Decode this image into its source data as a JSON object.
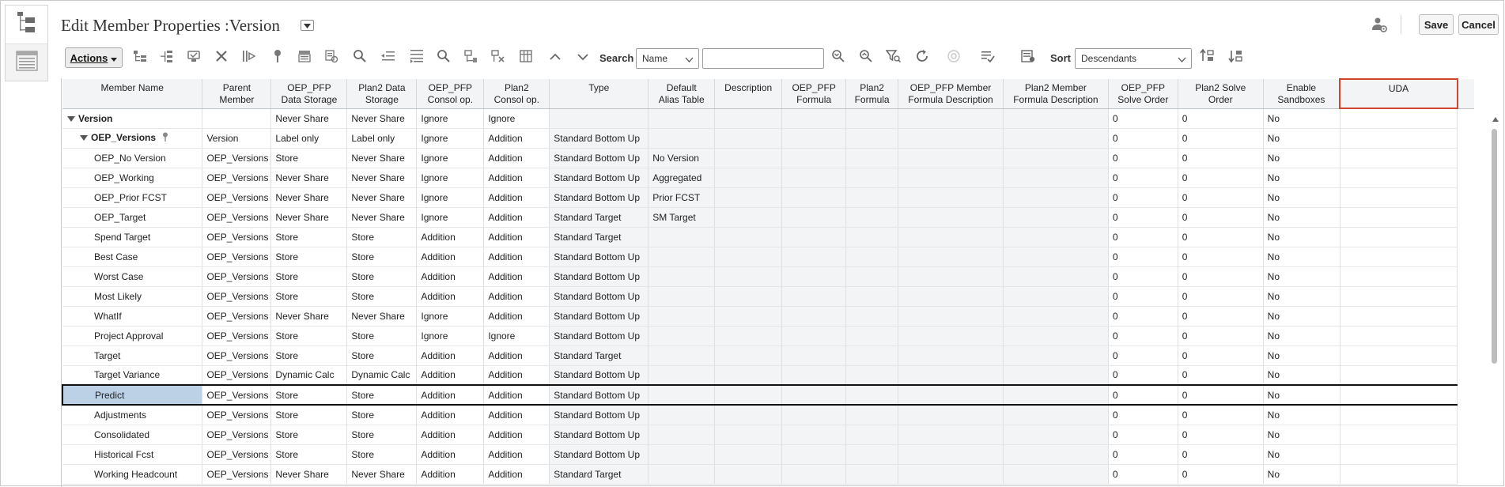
{
  "page": {
    "title": "Edit Member Properties :Version",
    "save_label": "Save",
    "cancel_label": "Cancel"
  },
  "toolbar": {
    "actions_label": "Actions",
    "search_label": "Search",
    "search_field_value": "Name",
    "search_input_value": "",
    "sort_label": "Sort",
    "sort_value": "Descendants"
  },
  "grid": {
    "columns": [
      "Member Name",
      "Parent Member",
      "OEP_PFP Data Storage",
      "Plan2 Data Storage",
      "OEP_PFP Consol op.",
      "Plan2 Consol op.",
      "Type",
      "Default Alias Table",
      "Description",
      "OEP_PFP Formula",
      "Plan2 Formula",
      "OEP_PFP Member Formula Description",
      "Plan2 Member Formula Description",
      "OEP_PFP Solve Order",
      "Plan2 Solve Order",
      "Enable Sandboxes",
      "UDA"
    ],
    "rows": [
      [
        "Version",
        "",
        "Never Share",
        "Never Share",
        "Ignore",
        "Ignore",
        "",
        "",
        "",
        "",
        "",
        "",
        "",
        "0",
        "0",
        "No",
        ""
      ],
      [
        "OEP_Versions",
        "Version",
        "Label only",
        "Label only",
        "Ignore",
        "Addition",
        "Standard Bottom Up",
        "",
        "",
        "",
        "",
        "",
        "",
        "0",
        "0",
        "No",
        ""
      ],
      [
        "OEP_No Version",
        "OEP_Versions",
        "Store",
        "Never Share",
        "Ignore",
        "Addition",
        "Standard Bottom Up",
        "No Version",
        "",
        "",
        "",
        "",
        "",
        "0",
        "0",
        "No",
        ""
      ],
      [
        "OEP_Working",
        "OEP_Versions",
        "Never Share",
        "Never Share",
        "Ignore",
        "Addition",
        "Standard Bottom Up",
        "Aggregated",
        "",
        "",
        "",
        "",
        "",
        "0",
        "0",
        "No",
        ""
      ],
      [
        "OEP_Prior FCST",
        "OEP_Versions",
        "Never Share",
        "Never Share",
        "Ignore",
        "Addition",
        "Standard Bottom Up",
        "Prior FCST",
        "",
        "",
        "",
        "",
        "",
        "0",
        "0",
        "No",
        ""
      ],
      [
        "OEP_Target",
        "OEP_Versions",
        "Never Share",
        "Never Share",
        "Ignore",
        "Addition",
        "Standard Target",
        "SM Target",
        "",
        "",
        "",
        "",
        "",
        "0",
        "0",
        "No",
        ""
      ],
      [
        "Spend Target",
        "OEP_Versions",
        "Store",
        "Store",
        "Addition",
        "Addition",
        "Standard Target",
        "",
        "",
        "",
        "",
        "",
        "",
        "0",
        "0",
        "No",
        ""
      ],
      [
        "Best Case",
        "OEP_Versions",
        "Store",
        "Store",
        "Addition",
        "Addition",
        "Standard Bottom Up",
        "",
        "",
        "",
        "",
        "",
        "",
        "0",
        "0",
        "No",
        ""
      ],
      [
        "Worst Case",
        "OEP_Versions",
        "Store",
        "Store",
        "Addition",
        "Addition",
        "Standard Bottom Up",
        "",
        "",
        "",
        "",
        "",
        "",
        "0",
        "0",
        "No",
        ""
      ],
      [
        "Most Likely",
        "OEP_Versions",
        "Store",
        "Store",
        "Addition",
        "Addition",
        "Standard Bottom Up",
        "",
        "",
        "",
        "",
        "",
        "",
        "0",
        "0",
        "No",
        ""
      ],
      [
        "WhatIf",
        "OEP_Versions",
        "Never Share",
        "Never Share",
        "Ignore",
        "Addition",
        "Standard Bottom Up",
        "",
        "",
        "",
        "",
        "",
        "",
        "0",
        "0",
        "No",
        ""
      ],
      [
        "Project Approval",
        "OEP_Versions",
        "Store",
        "Store",
        "Ignore",
        "Ignore",
        "Standard Bottom Up",
        "",
        "",
        "",
        "",
        "",
        "",
        "0",
        "0",
        "No",
        ""
      ],
      [
        "Target",
        "OEP_Versions",
        "Store",
        "Store",
        "Addition",
        "Addition",
        "Standard Target",
        "",
        "",
        "",
        "",
        "",
        "",
        "0",
        "0",
        "No",
        ""
      ],
      [
        "Target Variance",
        "OEP_Versions",
        "Dynamic Calc",
        "Dynamic Calc",
        "Addition",
        "Addition",
        "Standard Bottom Up",
        "",
        "",
        "",
        "",
        "",
        "",
        "0",
        "0",
        "No",
        ""
      ],
      [
        "Predict",
        "OEP_Versions",
        "Store",
        "Store",
        "Addition",
        "Addition",
        "Standard Bottom Up",
        "",
        "",
        "",
        "",
        "",
        "",
        "0",
        "0",
        "No",
        ""
      ],
      [
        "Adjustments",
        "OEP_Versions",
        "Store",
        "Store",
        "Addition",
        "Addition",
        "Standard Bottom Up",
        "",
        "",
        "",
        "",
        "",
        "",
        "0",
        "0",
        "No",
        ""
      ],
      [
        "Consolidated",
        "OEP_Versions",
        "Store",
        "Store",
        "Addition",
        "Addition",
        "Standard Bottom Up",
        "",
        "",
        "",
        "",
        "",
        "",
        "0",
        "0",
        "No",
        ""
      ],
      [
        "Historical Fcst",
        "OEP_Versions",
        "Store",
        "Store",
        "Addition",
        "Addition",
        "Standard Bottom Up",
        "",
        "",
        "",
        "",
        "",
        "",
        "0",
        "0",
        "No",
        ""
      ],
      [
        "Working Headcount",
        "OEP_Versions",
        "Never Share",
        "Never Share",
        "Addition",
        "Addition",
        "Standard Target",
        "",
        "",
        "",
        "",
        "",
        "",
        "0",
        "0",
        "No",
        ""
      ]
    ],
    "selected_row": "Predict"
  },
  "colors": {
    "header_bg": "#f2f4f6",
    "selected_cell": "#bcd0e6",
    "highlight_border": "#d0452d"
  }
}
